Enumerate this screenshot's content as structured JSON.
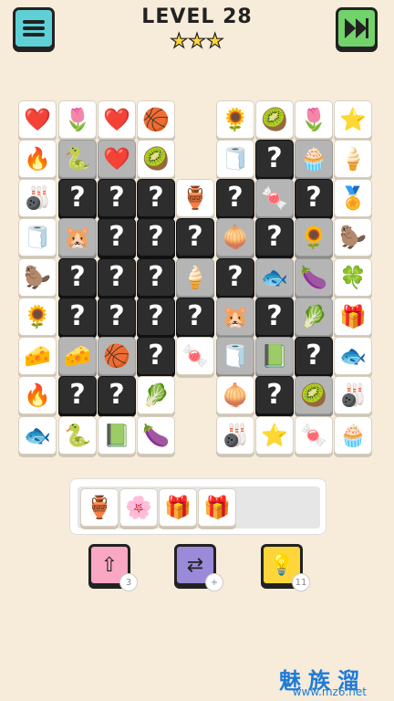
{
  "header": {
    "level_label": "LEVEL 28",
    "stars_display": "★★★",
    "menu_icon": "hamburger-menu-icon",
    "skip_icon": "fast-forward-ad-icon"
  },
  "board": {
    "tiles": [
      {
        "c": 0,
        "r": 0,
        "t": "normal",
        "sym": "❤️"
      },
      {
        "c": 1,
        "r": 0,
        "t": "normal",
        "sym": "🌷"
      },
      {
        "c": 2,
        "r": 0,
        "t": "normal",
        "sym": "❤️"
      },
      {
        "c": 3,
        "r": 0,
        "t": "normal",
        "sym": "🏀"
      },
      {
        "c": 5,
        "r": 0,
        "t": "normal",
        "sym": "🌻"
      },
      {
        "c": 6,
        "r": 0,
        "t": "normal",
        "sym": "🥝"
      },
      {
        "c": 7,
        "r": 0,
        "t": "normal",
        "sym": "🌷"
      },
      {
        "c": 8,
        "r": 0,
        "t": "normal",
        "sym": "⭐"
      },
      {
        "c": 0,
        "r": 1,
        "t": "normal",
        "sym": "🔥"
      },
      {
        "c": 1,
        "r": 1,
        "t": "grey",
        "sym": "🐍"
      },
      {
        "c": 2,
        "r": 1,
        "t": "grey",
        "sym": "❤️"
      },
      {
        "c": 3,
        "r": 1,
        "t": "normal",
        "sym": "🥝"
      },
      {
        "c": 5,
        "r": 1,
        "t": "normal",
        "sym": "🧻"
      },
      {
        "c": 6,
        "r": 1,
        "t": "hidden",
        "sym": "?"
      },
      {
        "c": 7,
        "r": 1,
        "t": "grey",
        "sym": "🧁"
      },
      {
        "c": 8,
        "r": 1,
        "t": "normal",
        "sym": "🍦"
      },
      {
        "c": 0,
        "r": 2,
        "t": "normal",
        "sym": "🎳"
      },
      {
        "c": 1,
        "r": 2,
        "t": "hidden",
        "sym": "?"
      },
      {
        "c": 2,
        "r": 2,
        "t": "hidden",
        "sym": "?"
      },
      {
        "c": 3,
        "r": 2,
        "t": "hidden",
        "sym": "?"
      },
      {
        "c": 4,
        "r": 2,
        "t": "normal",
        "sym": "🏺"
      },
      {
        "c": 5,
        "r": 2,
        "t": "hidden",
        "sym": "?"
      },
      {
        "c": 6,
        "r": 2,
        "t": "grey",
        "sym": "🍬"
      },
      {
        "c": 7,
        "r": 2,
        "t": "hidden",
        "sym": "?"
      },
      {
        "c": 8,
        "r": 2,
        "t": "normal",
        "sym": "🏅"
      },
      {
        "c": 0,
        "r": 3,
        "t": "normal",
        "sym": "🧻"
      },
      {
        "c": 1,
        "r": 3,
        "t": "grey",
        "sym": "🐹"
      },
      {
        "c": 2,
        "r": 3,
        "t": "hidden",
        "sym": "?"
      },
      {
        "c": 3,
        "r": 3,
        "t": "hidden",
        "sym": "?"
      },
      {
        "c": 4,
        "r": 3,
        "t": "hidden",
        "sym": "?"
      },
      {
        "c": 5,
        "r": 3,
        "t": "grey",
        "sym": "🧅"
      },
      {
        "c": 6,
        "r": 3,
        "t": "hidden",
        "sym": "?"
      },
      {
        "c": 7,
        "r": 3,
        "t": "grey",
        "sym": "🌻"
      },
      {
        "c": 8,
        "r": 3,
        "t": "normal",
        "sym": "🦫"
      },
      {
        "c": 0,
        "r": 4,
        "t": "normal",
        "sym": "🦫"
      },
      {
        "c": 1,
        "r": 4,
        "t": "hidden",
        "sym": "?"
      },
      {
        "c": 2,
        "r": 4,
        "t": "hidden",
        "sym": "?"
      },
      {
        "c": 3,
        "r": 4,
        "t": "hidden",
        "sym": "?"
      },
      {
        "c": 4,
        "r": 4,
        "t": "grey",
        "sym": "🍦"
      },
      {
        "c": 5,
        "r": 4,
        "t": "hidden",
        "sym": "?"
      },
      {
        "c": 6,
        "r": 4,
        "t": "grey",
        "sym": "🐟"
      },
      {
        "c": 7,
        "r": 4,
        "t": "grey",
        "sym": "🍆"
      },
      {
        "c": 8,
        "r": 4,
        "t": "normal",
        "sym": "🍀"
      },
      {
        "c": 0,
        "r": 5,
        "t": "normal",
        "sym": "🌻"
      },
      {
        "c": 1,
        "r": 5,
        "t": "hidden",
        "sym": "?"
      },
      {
        "c": 2,
        "r": 5,
        "t": "hidden",
        "sym": "?"
      },
      {
        "c": 3,
        "r": 5,
        "t": "hidden",
        "sym": "?"
      },
      {
        "c": 4,
        "r": 5,
        "t": "hidden",
        "sym": "?"
      },
      {
        "c": 5,
        "r": 5,
        "t": "grey",
        "sym": "🐹"
      },
      {
        "c": 6,
        "r": 5,
        "t": "hidden",
        "sym": "?"
      },
      {
        "c": 7,
        "r": 5,
        "t": "grey",
        "sym": "🥬"
      },
      {
        "c": 8,
        "r": 5,
        "t": "normal",
        "sym": "🎁"
      },
      {
        "c": 0,
        "r": 6,
        "t": "normal",
        "sym": "🧀"
      },
      {
        "c": 1,
        "r": 6,
        "t": "grey",
        "sym": "🧀"
      },
      {
        "c": 2,
        "r": 6,
        "t": "grey",
        "sym": "🏀"
      },
      {
        "c": 3,
        "r": 6,
        "t": "hidden",
        "sym": "?"
      },
      {
        "c": 4,
        "r": 6,
        "t": "normal",
        "sym": "🍬"
      },
      {
        "c": 5,
        "r": 6,
        "t": "grey",
        "sym": "🧻"
      },
      {
        "c": 6,
        "r": 6,
        "t": "grey",
        "sym": "📗"
      },
      {
        "c": 7,
        "r": 6,
        "t": "hidden",
        "sym": "?"
      },
      {
        "c": 8,
        "r": 6,
        "t": "normal",
        "sym": "🐟"
      },
      {
        "c": 0,
        "r": 7,
        "t": "normal",
        "sym": "🔥"
      },
      {
        "c": 1,
        "r": 7,
        "t": "hidden",
        "sym": "?"
      },
      {
        "c": 2,
        "r": 7,
        "t": "hidden",
        "sym": "?"
      },
      {
        "c": 3,
        "r": 7,
        "t": "normal",
        "sym": "🥬"
      },
      {
        "c": 5,
        "r": 7,
        "t": "normal",
        "sym": "🧅"
      },
      {
        "c": 6,
        "r": 7,
        "t": "hidden",
        "sym": "?"
      },
      {
        "c": 7,
        "r": 7,
        "t": "grey",
        "sym": "🥝"
      },
      {
        "c": 8,
        "r": 7,
        "t": "normal",
        "sym": "🎳"
      },
      {
        "c": 0,
        "r": 8,
        "t": "normal",
        "sym": "🐟"
      },
      {
        "c": 1,
        "r": 8,
        "t": "normal",
        "sym": "🐍"
      },
      {
        "c": 2,
        "r": 8,
        "t": "normal",
        "sym": "📗"
      },
      {
        "c": 3,
        "r": 8,
        "t": "normal",
        "sym": "🍆"
      },
      {
        "c": 5,
        "r": 8,
        "t": "normal",
        "sym": "🎳"
      },
      {
        "c": 6,
        "r": 8,
        "t": "normal",
        "sym": "⭐"
      },
      {
        "c": 7,
        "r": 8,
        "t": "normal",
        "sym": "🍬"
      },
      {
        "c": 8,
        "r": 8,
        "t": "normal",
        "sym": "🧁"
      }
    ]
  },
  "tray": {
    "slots": [
      "🏺",
      "🌸",
      "🎁",
      "🎁"
    ]
  },
  "powerups": {
    "undo": {
      "icon": "undo-arrow-icon",
      "glyph": "⇧",
      "count": "3"
    },
    "shuffle": {
      "icon": "shuffle-icon",
      "glyph": "⇄",
      "count": "+"
    },
    "hint": {
      "icon": "lightbulb-icon",
      "glyph": "💡",
      "count": "11"
    }
  },
  "watermark": {
    "text": "魅族溜",
    "url": "www.mz6.net"
  }
}
